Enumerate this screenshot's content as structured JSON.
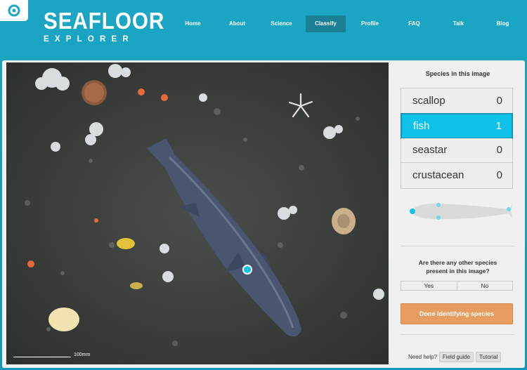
{
  "logo": {
    "title": "SEAFLOOR",
    "subtitle": "EXPLORER"
  },
  "nav": [
    "Home",
    "About",
    "Science",
    "Classify",
    "Profile",
    "FAQ",
    "Talk",
    "Blog"
  ],
  "nav_active": "Classify",
  "sidebar": {
    "title": "Species in this image",
    "species": [
      {
        "name": "scallop",
        "count": "0",
        "selected": false
      },
      {
        "name": "fish",
        "count": "1",
        "selected": true
      },
      {
        "name": "seastar",
        "count": "0",
        "selected": false
      },
      {
        "name": "crustacean",
        "count": "0",
        "selected": false
      }
    ],
    "question_line1": "Are there any other species",
    "question_line2": "present in this image?",
    "yes_label": "Yes",
    "no_label": "No",
    "done_label": "Done identifying species",
    "help_label": "Need help?",
    "field_guide_label": "Field guide",
    "tutorial_label": "Tutorial"
  },
  "photo": {
    "scale_label": "100mm"
  },
  "colors": {
    "accent": "#0fc2ea",
    "header": "#1aa6c4",
    "done": "#e89c5f"
  }
}
